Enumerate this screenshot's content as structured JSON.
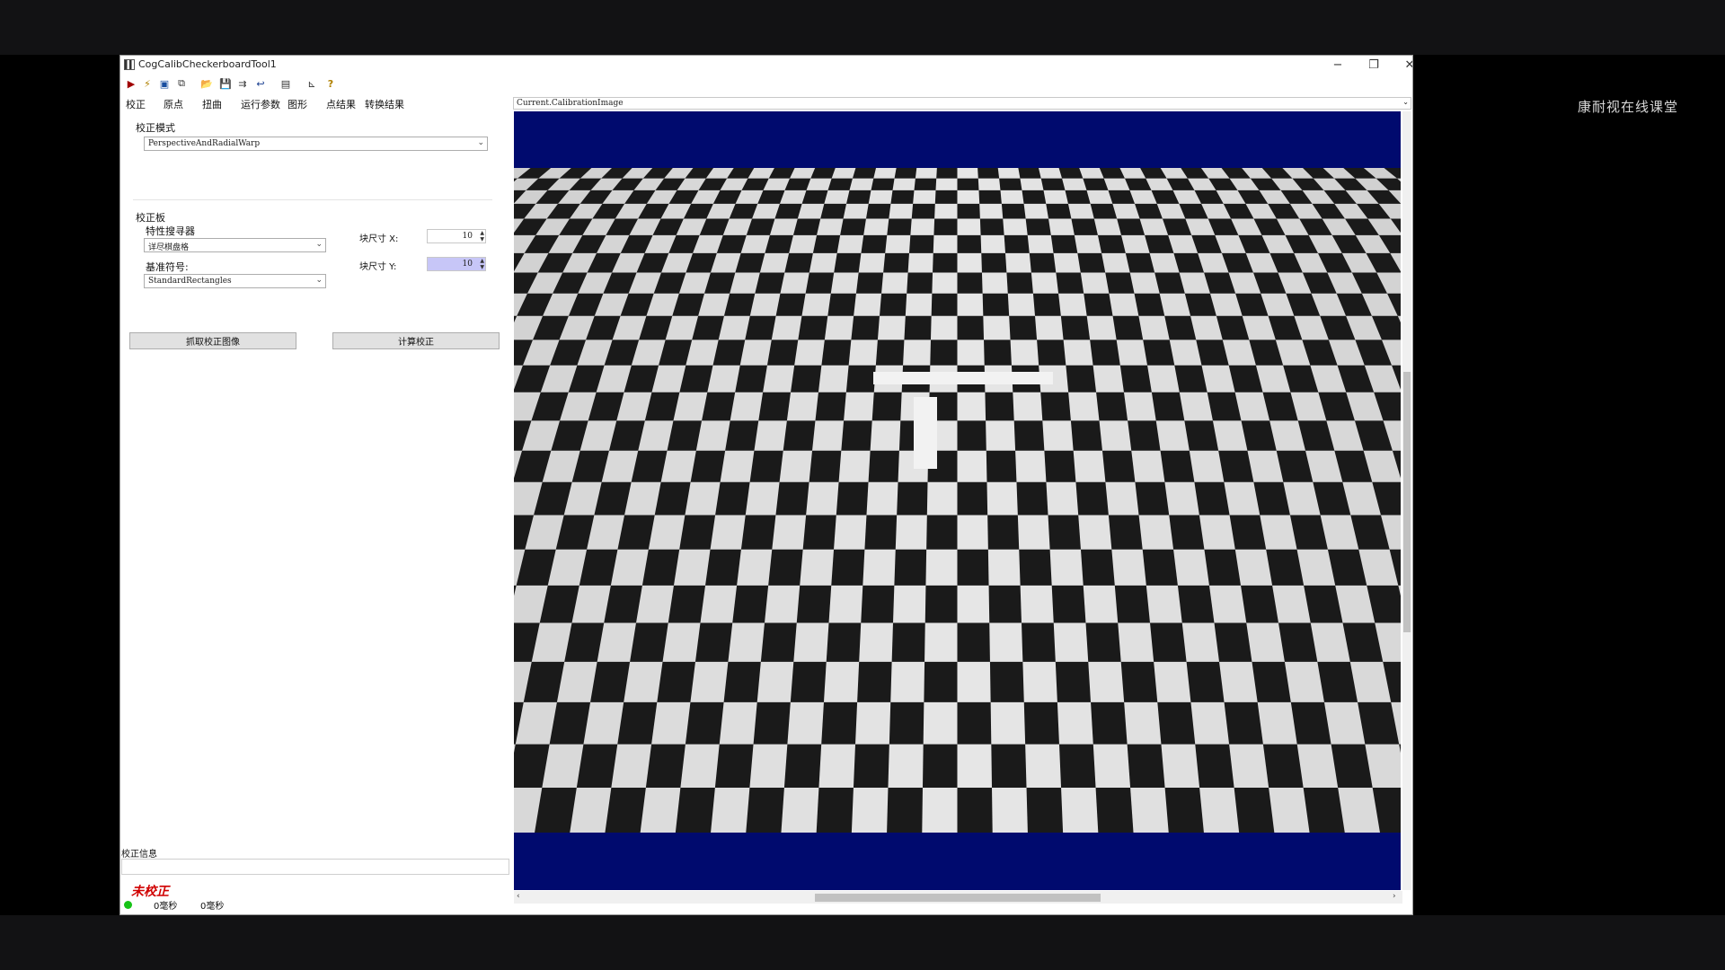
{
  "watermark": "康耐视在线课堂",
  "window": {
    "title": "CogCalibCheckerboardTool1",
    "controls": {
      "minimize": "−",
      "restore": "❐",
      "close": "✕"
    }
  },
  "toolbar": {
    "icons": [
      "run-icon",
      "wand-icon",
      "display-icon",
      "copy-icon",
      "open-folder-icon",
      "save-icon",
      "save-as-icon",
      "reset-icon",
      "image-icon",
      "graph-icon",
      "help-icon"
    ],
    "glyphs": [
      "▶",
      "⚡",
      "▣",
      "⧉",
      "📂",
      "💾",
      "⇉",
      "↩",
      "▤",
      "⊾",
      "?"
    ]
  },
  "tabs": [
    "校正",
    "原点",
    "扭曲",
    "运行参数",
    "图形",
    "点结果",
    "转换结果"
  ],
  "calibration": {
    "mode_label": "校正模式",
    "mode_value": "PerspectiveAndRadialWarp",
    "plate_label": "校正板",
    "feature_finder_label": "特性搜寻器",
    "feature_finder_value": "详尽棋盘格",
    "fiducial_label": "基准符号:",
    "fiducial_value": "StandardRectangles",
    "tile_x_label": "块尺寸 X:",
    "tile_x_value": "10",
    "tile_y_label": "块尺寸 Y:",
    "tile_y_value": "10",
    "grab_button": "抓取校正图像",
    "compute_button": "计算校正"
  },
  "info": {
    "label": "校正信息",
    "status": "未校正",
    "time1": "0毫秒",
    "time2": "0毫秒"
  },
  "viewer": {
    "selected_image": "Current.CalibrationImage",
    "vertical_scroll_position": 0.33,
    "horizontal_scroll_position": 0.34
  },
  "colors": {
    "image_background": "#000a6e",
    "status_red": "#d00000",
    "led_green": "#17c317",
    "selection_highlight": "#c7c6f7"
  }
}
